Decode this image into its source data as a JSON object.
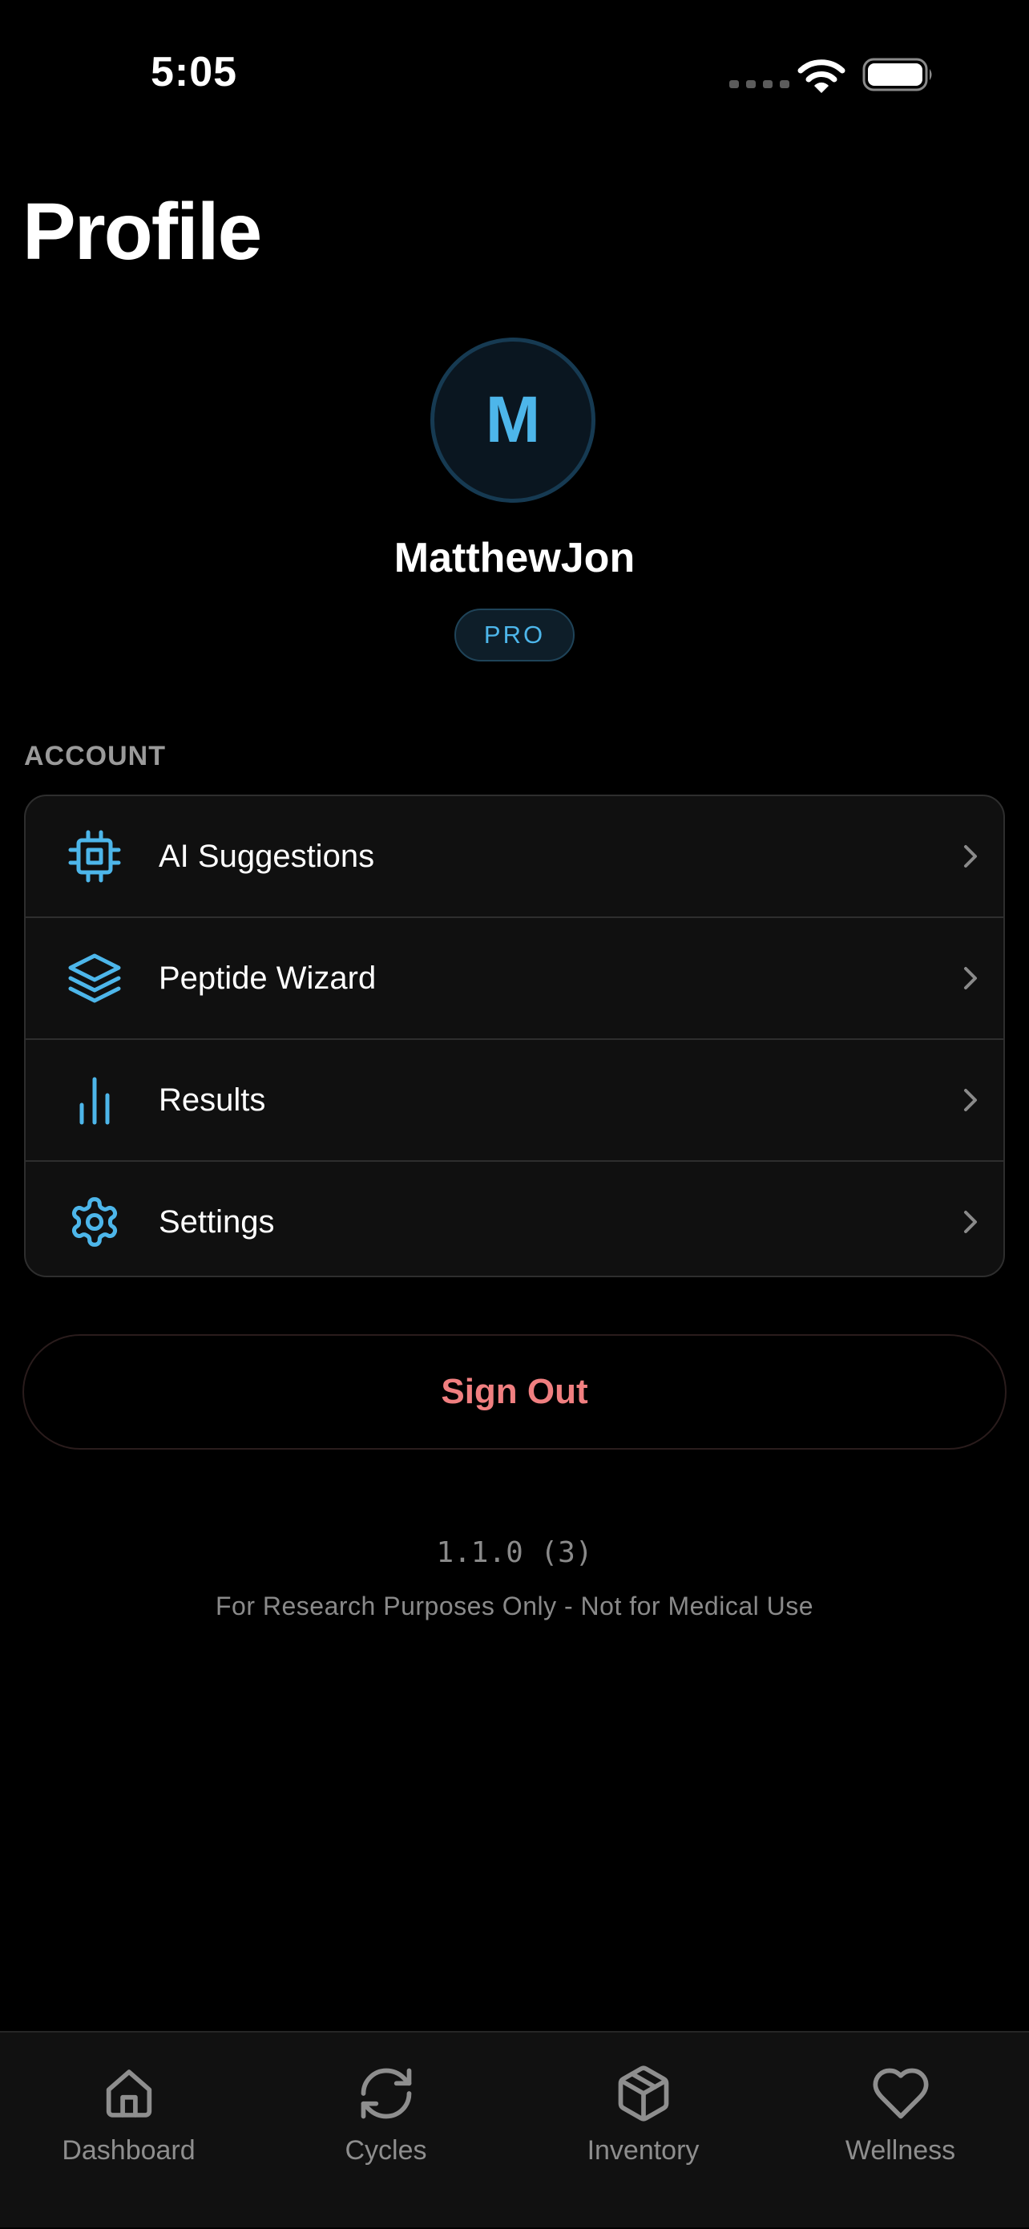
{
  "status_bar": {
    "time": "5:05"
  },
  "page": {
    "title": "Profile"
  },
  "profile": {
    "avatar_initial": "M",
    "username": "MatthewJon",
    "badge": "PRO"
  },
  "account": {
    "header": "ACCOUNT",
    "items": [
      {
        "label": "AI Suggestions",
        "icon": "cpu-chip-icon"
      },
      {
        "label": "Peptide Wizard",
        "icon": "layers-stack-icon"
      },
      {
        "label": "Results",
        "icon": "bar-chart-icon"
      },
      {
        "label": "Settings",
        "icon": "gear-icon"
      }
    ]
  },
  "sign_out": {
    "label": "Sign Out"
  },
  "footer": {
    "version": "1.1.0 (3)",
    "disclaimer": "For Research Purposes Only - Not for Medical Use"
  },
  "tab_bar": {
    "tabs": [
      {
        "label": "Dashboard",
        "icon": "home-icon"
      },
      {
        "label": "Cycles",
        "icon": "refresh-cycle-icon"
      },
      {
        "label": "Inventory",
        "icon": "box-icon"
      },
      {
        "label": "Wellness",
        "icon": "heart-icon"
      }
    ]
  },
  "colors": {
    "background": "#000000",
    "card": "#101010",
    "accent": "#4db6ea",
    "sign_out": "#f07f80",
    "muted_text": "#8e8e8e"
  }
}
